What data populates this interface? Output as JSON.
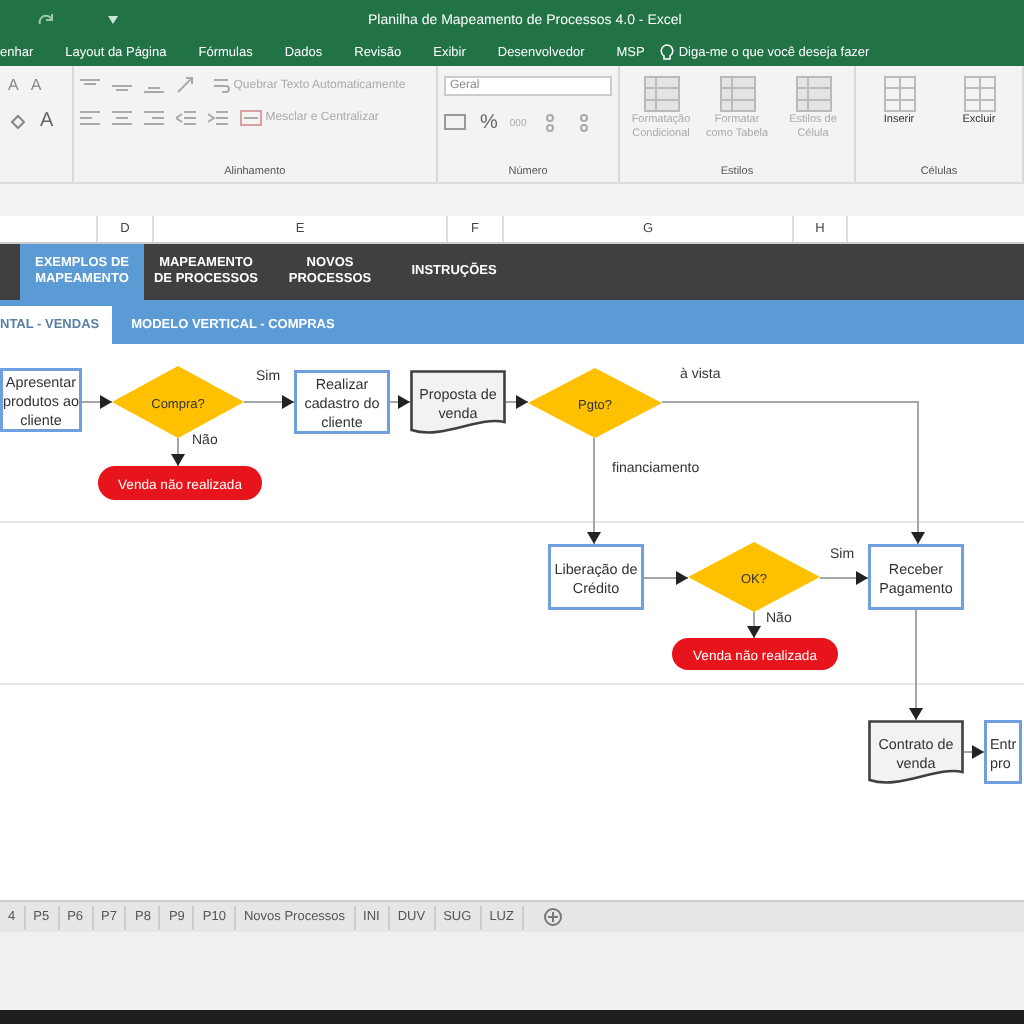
{
  "window": {
    "title": "Planilha de Mapeamento de Processos 4.0  -  Excel"
  },
  "ribbon_tabs": [
    "enhar",
    "Layout da Página",
    "Fórmulas",
    "Dados",
    "Revisão",
    "Exibir",
    "Desenvolvedor",
    "MSP"
  ],
  "tell_me": "Diga-me o que você deseja fazer",
  "ribbon": {
    "font_buttons": [
      "A",
      "A",
      "A"
    ],
    "wrap_text": "Quebrar Texto Automaticamente",
    "merge": "Mesclar e Centralizar",
    "alignment_label": "Alinhamento",
    "number_format": "Geral",
    "percent": "%",
    "thousands": "000",
    "number_label": "Número",
    "styles": [
      "Formatação Condicional",
      "Formatar como Tabela",
      "Estilos de Célula"
    ],
    "styles_label": "Estilos",
    "cells": [
      "Inserir",
      "Excluir"
    ],
    "cells_label": "Células"
  },
  "columns": [
    "D",
    "E",
    "F",
    "G",
    "H"
  ],
  "nav_tabs": [
    {
      "label": "EXEMPLOS DE MAPEAMENTO",
      "selected": true
    },
    {
      "label": "MAPEAMENTO DE PROCESSOS",
      "selected": false
    },
    {
      "label": "NOVOS PROCESSOS",
      "selected": false
    },
    {
      "label": "INSTRUÇÕES",
      "selected": false
    }
  ],
  "sub_tabs": [
    {
      "label": "NTAL - VENDAS",
      "selected": true
    },
    {
      "label": "MODELO VERTICAL - COMPRAS",
      "selected": false
    }
  ],
  "flowchart": {
    "nodes": [
      {
        "kind": "process",
        "text": "Apresentar produtos ao cliente"
      },
      {
        "kind": "decision",
        "text": "Compra?"
      },
      {
        "kind": "terminator",
        "text": "Venda não realizada"
      },
      {
        "kind": "process",
        "text": "Realizar cadastro do cliente"
      },
      {
        "kind": "document",
        "text": "Proposta de venda"
      },
      {
        "kind": "decision",
        "text": "Pgto?"
      },
      {
        "kind": "process",
        "text": "Liberação de Crédito"
      },
      {
        "kind": "decision",
        "text": "OK?"
      },
      {
        "kind": "terminator",
        "text": "Venda não realizada"
      },
      {
        "kind": "process",
        "text": "Receber Pagamento"
      },
      {
        "kind": "document",
        "text": "Contrato de venda"
      },
      {
        "kind": "process",
        "text": "Entr pro"
      }
    ],
    "edge_labels": [
      "Sim",
      "Não",
      "à vista",
      "financiamento",
      "Sim",
      "Não"
    ]
  },
  "sheet_tabs": [
    "4",
    "P5",
    "P6",
    "P7",
    "P8",
    "P9",
    "P10",
    "Novos Processos",
    "INI",
    "DUV",
    "SUG",
    "LUZ"
  ]
}
